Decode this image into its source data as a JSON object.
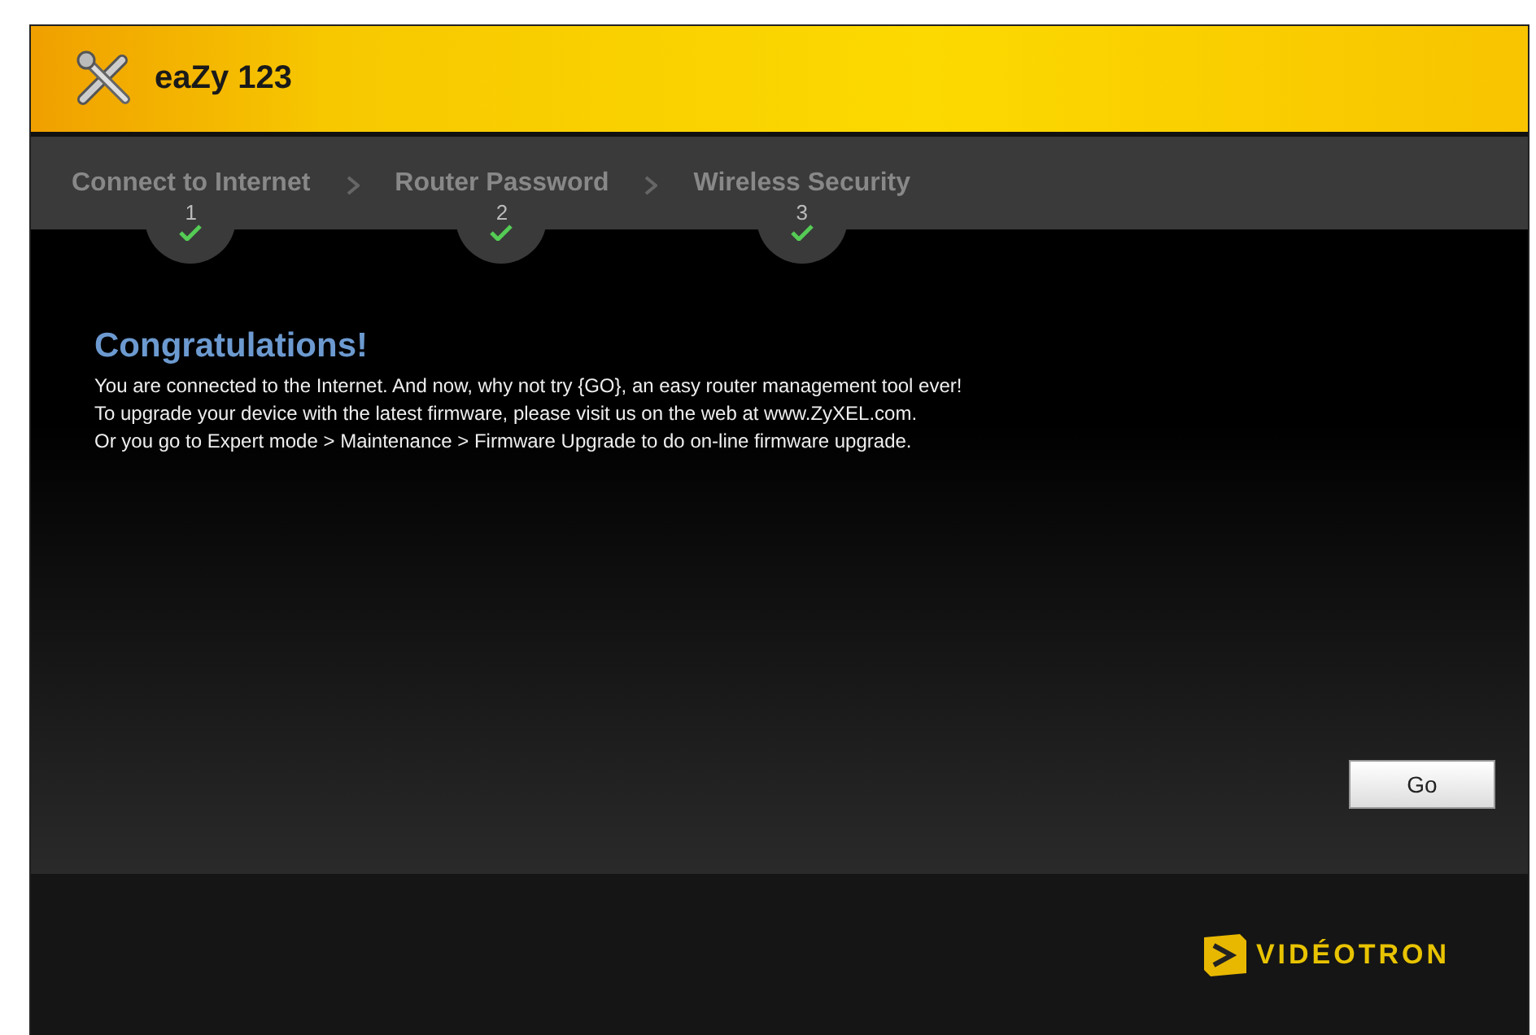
{
  "header": {
    "title": "eaZy 123"
  },
  "steps": [
    {
      "label": "Connect to Internet",
      "number": "1",
      "done": true
    },
    {
      "label": "Router Password",
      "number": "2",
      "done": true
    },
    {
      "label": "Wireless Security",
      "number": "3",
      "done": true
    }
  ],
  "message": {
    "heading": "Congratulations!",
    "lines": [
      "You are connected to the Internet. And now, why not try {GO}, an easy router management tool ever!",
      "To upgrade your device with the latest firmware, please visit us on the web at www.ZyXEL.com.",
      "Or you go to Expert mode > Maintenance > Firmware Upgrade to do on-line firmware upgrade."
    ]
  },
  "go_button": "Go",
  "footer": {
    "brand": "VIDÉOTRON"
  }
}
